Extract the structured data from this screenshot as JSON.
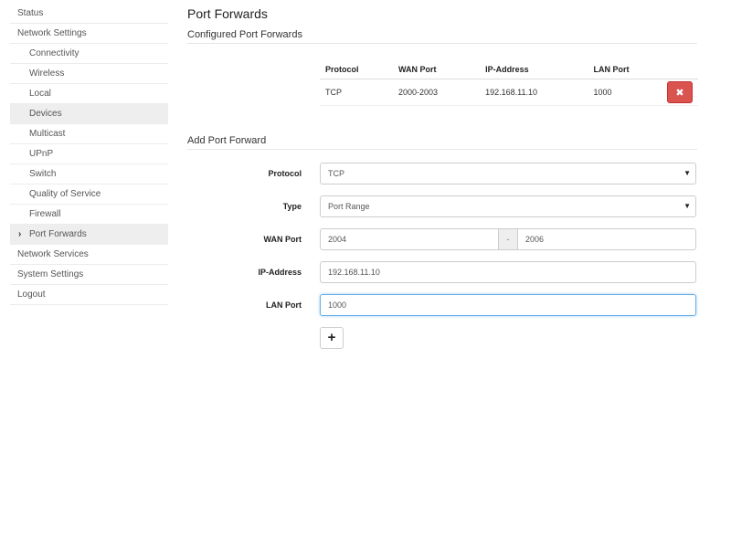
{
  "sidebar": {
    "items": [
      {
        "label": "Status"
      },
      {
        "label": "Network Settings"
      },
      {
        "label": "Connectivity"
      },
      {
        "label": "Wireless"
      },
      {
        "label": "Local"
      },
      {
        "label": "Devices"
      },
      {
        "label": "Multicast"
      },
      {
        "label": "UPnP"
      },
      {
        "label": "Switch"
      },
      {
        "label": "Quality of Service"
      },
      {
        "label": "Firewall"
      },
      {
        "label": "Port Forwards"
      },
      {
        "label": "Network Services"
      },
      {
        "label": "System Settings"
      },
      {
        "label": "Logout"
      }
    ],
    "chevron": "›"
  },
  "main": {
    "title": "Port Forwards",
    "configured_heading": "Configured Port Forwards",
    "add_heading": "Add Port Forward"
  },
  "table": {
    "headers": [
      "Protocol",
      "WAN Port",
      "IP-Address",
      "LAN Port"
    ],
    "rows": [
      {
        "protocol": "TCP",
        "wan_port": "2000-2003",
        "ip": "192.168.11.10",
        "lan_port": "1000",
        "delete_icon": "✖"
      }
    ]
  },
  "form": {
    "protocol_label": "Protocol",
    "protocol_value": "TCP",
    "type_label": "Type",
    "type_value": "Port Range",
    "wan_label": "WAN Port",
    "wan_from": "2004",
    "wan_sep": "-",
    "wan_to": "2006",
    "ip_label": "IP-Address",
    "ip_value": "192.168.11.10",
    "lan_label": "LAN Port",
    "lan_value": "1000",
    "select_arrow": "▼",
    "add_icon": "+"
  },
  "colors": {
    "delete_button": "#d9534f",
    "focus_border": "#66afe9",
    "active_item": "#eeeeee"
  }
}
